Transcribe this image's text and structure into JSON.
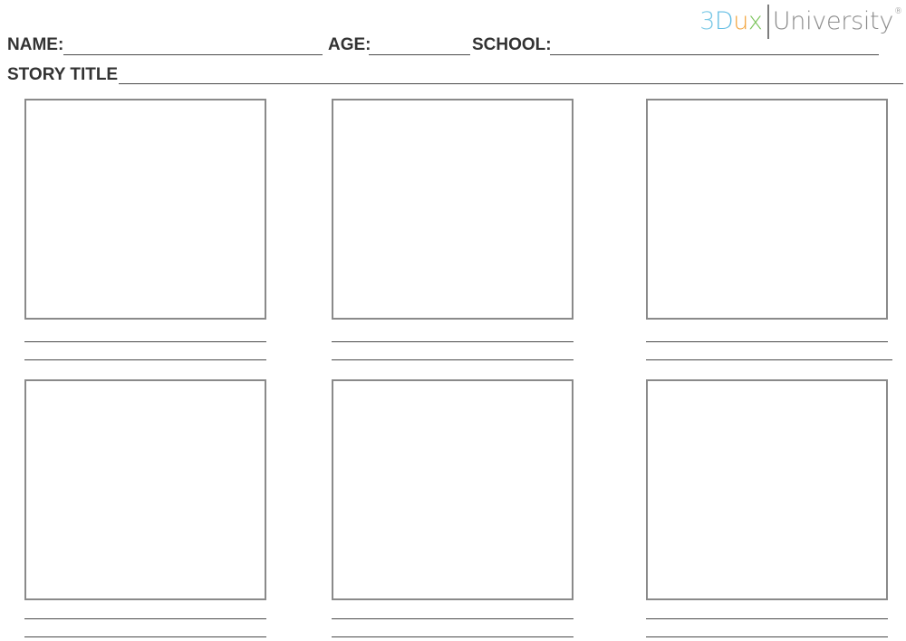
{
  "logo": {
    "mark_letters": [
      {
        "char": "3",
        "color": "#7cc9e6"
      },
      {
        "char": "D",
        "color": "#62bde3"
      },
      {
        "char": "u",
        "color": "#f2a33a"
      },
      {
        "char": "x",
        "color": "#7cc45c"
      }
    ],
    "word": "University",
    "registered": "®"
  },
  "form": {
    "name_label": "NAME:",
    "age_label": "AGE:",
    "school_label": "SCHOOL:",
    "story_title_label": "STORY TITLE"
  },
  "storyboard": {
    "rows": 2,
    "columns": 3,
    "panel_count": 6,
    "caption_lines_per_panel": 2
  }
}
